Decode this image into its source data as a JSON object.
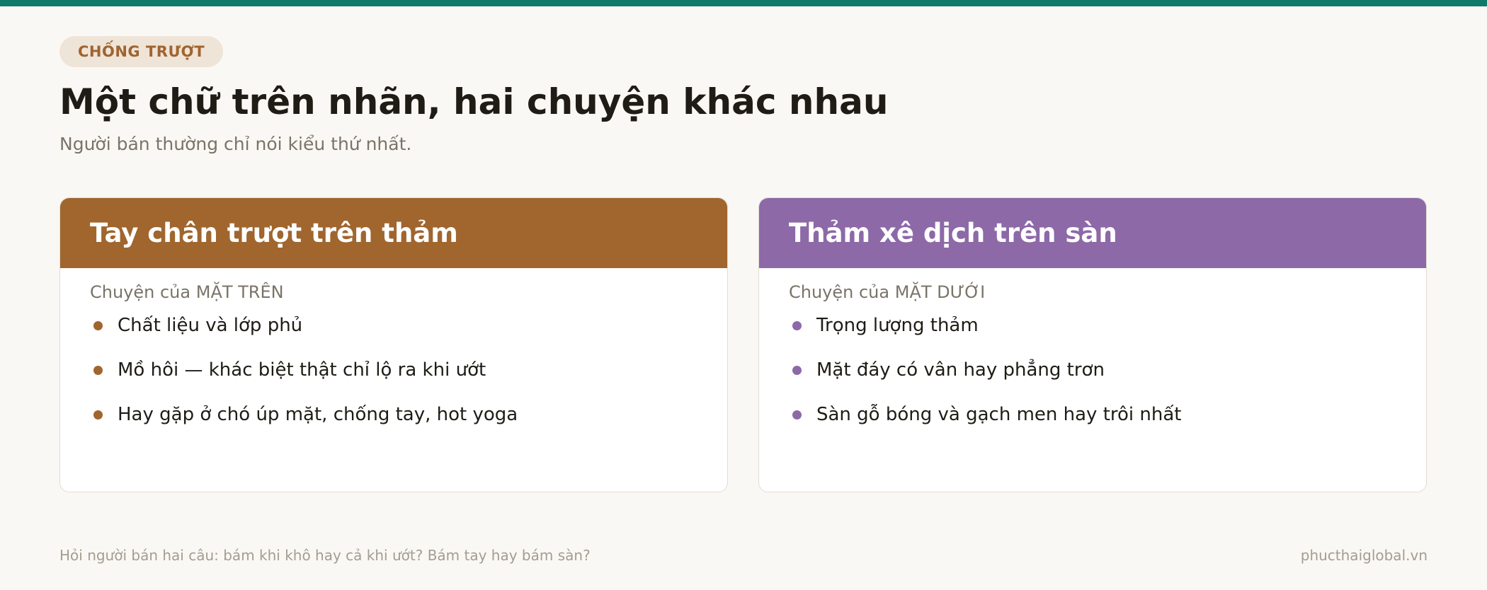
{
  "tag": "CHỐNG TRƯỢT",
  "title": "Một chữ trên nhãn, hai chuyện khác nhau",
  "subtitle": "Người bán thường chỉ nói kiểu thứ nhất.",
  "colors": {
    "accent_top": "#0f7a6b",
    "card_left": "#a0662e",
    "card_right": "#8d69a8"
  },
  "cards": [
    {
      "heading": "Tay chân trượt trên thảm",
      "sub": "Chuyện của MẶT TRÊN",
      "items": [
        "Chất liệu và lớp phủ",
        "Mồ hôi — khác biệt thật chỉ lộ ra khi ướt",
        "Hay gặp ở chó úp mặt, chống tay, hot yoga"
      ]
    },
    {
      "heading": "Thảm xê dịch trên sàn",
      "sub": "Chuyện của MẶT DƯỚI",
      "items": [
        "Trọng lượng thảm",
        "Mặt đáy có vân hay phẳng trơn",
        "Sàn gỗ bóng và gạch men hay trôi nhất"
      ]
    }
  ],
  "footer": {
    "note": "Hỏi người bán hai câu: bám khi khô hay cả khi ướt? Bám tay hay bám sàn?",
    "site": "phucthaiglobal.vn"
  }
}
